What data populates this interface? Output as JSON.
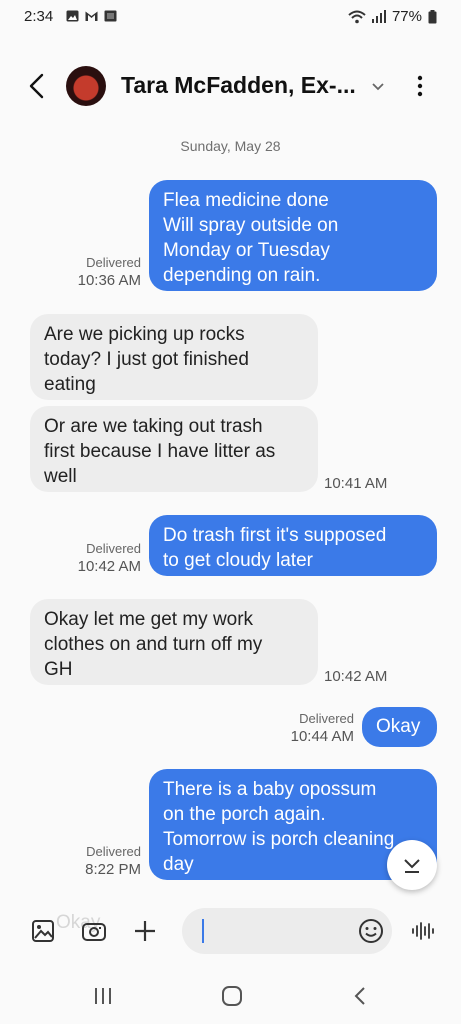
{
  "status": {
    "time": "2:34",
    "battery": "77%"
  },
  "header": {
    "contact_name": "Tara McFadden, Ex-..."
  },
  "date_separator": "Sunday, May 28",
  "messages": [
    {
      "dir": "out",
      "text": "Flea medicine done\nWill spray outside on\nMonday or Tuesday\ndepending on rain.",
      "status": "Delivered",
      "time": "10:36 AM"
    },
    {
      "dir": "in",
      "text": "Are we picking up rocks\ntoday? I just got finished\neating"
    },
    {
      "dir": "in",
      "text": "Or are we taking out trash\nfirst because I have litter as\nwell",
      "time": "10:41 AM"
    },
    {
      "dir": "out",
      "text": "Do trash first it's supposed\nto get cloudy later",
      "status": "Delivered",
      "time": "10:42 AM"
    },
    {
      "dir": "in",
      "text": "Okay let me get my work\nclothes on and turn off my\nGH",
      "time": "10:42 AM"
    },
    {
      "dir": "out",
      "text": "Okay",
      "status": "Delivered",
      "time": "10:44 AM"
    },
    {
      "dir": "out",
      "text": "There is a baby opossum\non the porch again.\nTomorrow is porch cleaning\nday",
      "status": "Delivered",
      "time": "8:22 PM"
    }
  ],
  "composer": {
    "ghost_text": "Okay"
  },
  "icons": {
    "back": "back-arrow-icon",
    "more": "more-vert-icon",
    "gallery": "gallery-icon",
    "camera": "camera-icon",
    "add": "plus-icon",
    "emoji": "emoji-icon",
    "voice": "voice-wave-icon",
    "scroll": "chevron-down-icon"
  }
}
